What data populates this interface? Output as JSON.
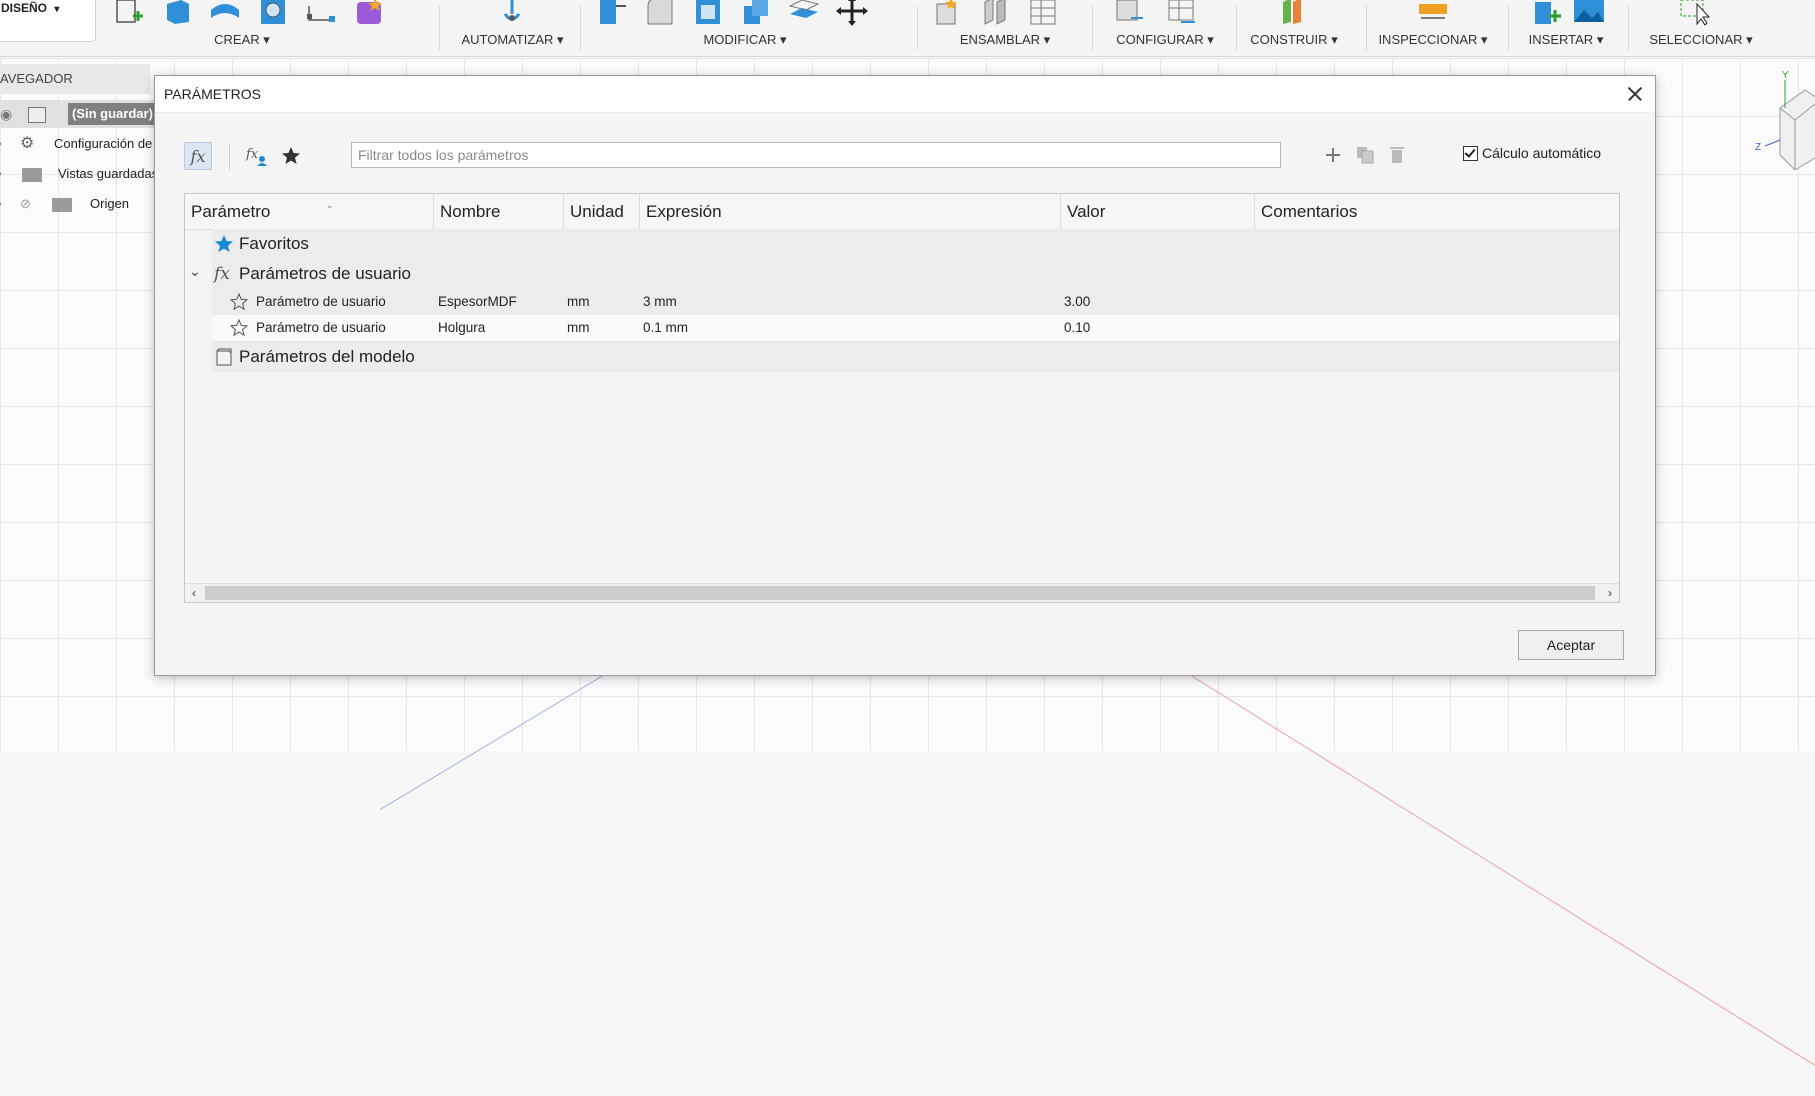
{
  "toolbar": {
    "workspace": "DISEÑO",
    "groups": [
      "CREAR",
      "AUTOMATIZAR",
      "MODIFICAR",
      "ENSAMBLAR",
      "CONFIGURAR",
      "CONSTRUIR",
      "INSPECCIONAR",
      "INSERTAR",
      "SELECCIONAR"
    ],
    "caret": "▾"
  },
  "browser": {
    "title": "AVEGADOR",
    "root": "(Sin guardar)",
    "items": [
      "Configuración de",
      "Vistas guardadas",
      "Origen"
    ]
  },
  "dialog": {
    "title": "PARÁMETROS",
    "filter_placeholder": "Filtrar todos los parámetros",
    "auto_calc_label": "Cálculo automático",
    "auto_calc_checked": true,
    "ok_label": "Aceptar",
    "columns": [
      "Parámetro",
      "Nombre",
      "Unidad",
      "Expresión",
      "Valor",
      "Comentarios"
    ],
    "groups": {
      "favorites": "Favoritos",
      "user": "Parámetros de usuario",
      "model": "Parámetros del modelo"
    },
    "rows": [
      {
        "parameter": "Parámetro de usuario",
        "name": "EspesorMDF",
        "unit": "mm",
        "expression": "3 mm",
        "value": "3.00",
        "comment": ""
      },
      {
        "parameter": "Parámetro de usuario",
        "name": "Holgura",
        "unit": "mm",
        "expression": "0.1 mm",
        "value": "0.10",
        "comment": ""
      }
    ]
  },
  "colors": {
    "accent": "#1a8ad4",
    "table_group_bg": "#ececec"
  }
}
